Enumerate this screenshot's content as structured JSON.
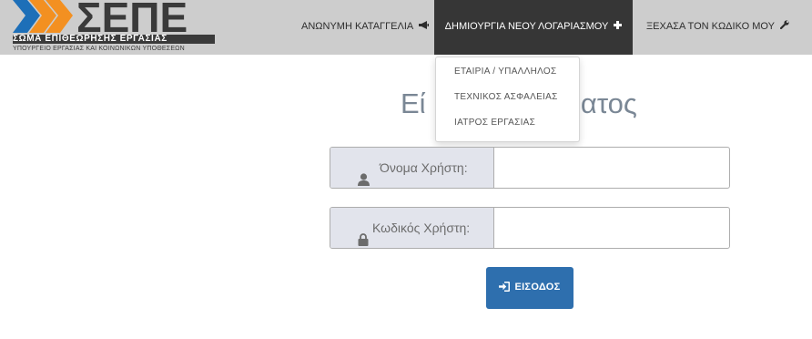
{
  "logo": {
    "letters": "ΣΕΠΕ",
    "subtitle": "ΣΩΜΑ ΕΠΙΘΕΩΡΗΣΗΣ ΕΡΓΑΣΙΑΣ",
    "ministry": "ΥΠΟΥΡΓΕΙΟ ΕΡΓΑΣΙΑΣ ΚΑΙ ΚΟΙΝΩΝΙΚΩΝ ΥΠΟΘΕΣΕΩΝ",
    "accent_color": "#f39021",
    "dark_color": "#3a3a3a"
  },
  "nav": {
    "anonymous_report": {
      "label": "ΑΝΩΝΥΜΗ ΚΑΤΑΓΓΕΛΙΑ",
      "icon": "bullhorn-icon"
    },
    "create_account": {
      "label": "ΔΗΜΙΟΥΡΓΙΑ ΝΕΟΥ ΛΟΓΑΡΙΑΣΜΟΥ",
      "icon": "plus-icon"
    },
    "forgot_password": {
      "label": "ΞΕΧΑΣΑ ΤΟΝ ΚΩΔΙΚΟ ΜΟΥ",
      "icon": "wrench-icon"
    }
  },
  "dropdown": {
    "items": [
      "ΕΤΑΙΡΙΑ / ΥΠΑΛΛΗΛΟΣ",
      "ΤΕΧΝΙΚΟΣ ΑΣΦΑΛΕΙΑΣ",
      "ΙΑΤΡΟΣ ΕΡΓΑΣΙΑΣ"
    ]
  },
  "main": {
    "heading_start": "Εί",
    "heading_end": "ηματος"
  },
  "form": {
    "username": {
      "label": "Όνομα Χρήστη:",
      "value": "",
      "icon": "user-icon"
    },
    "password": {
      "label": "Κωδικός Χρήστη:",
      "value": "",
      "icon": "lock-icon"
    },
    "login_button": {
      "label": "ΕΙΣΟΔΟΣ",
      "icon": "sign-in-icon",
      "color": "#2e6fae"
    }
  }
}
